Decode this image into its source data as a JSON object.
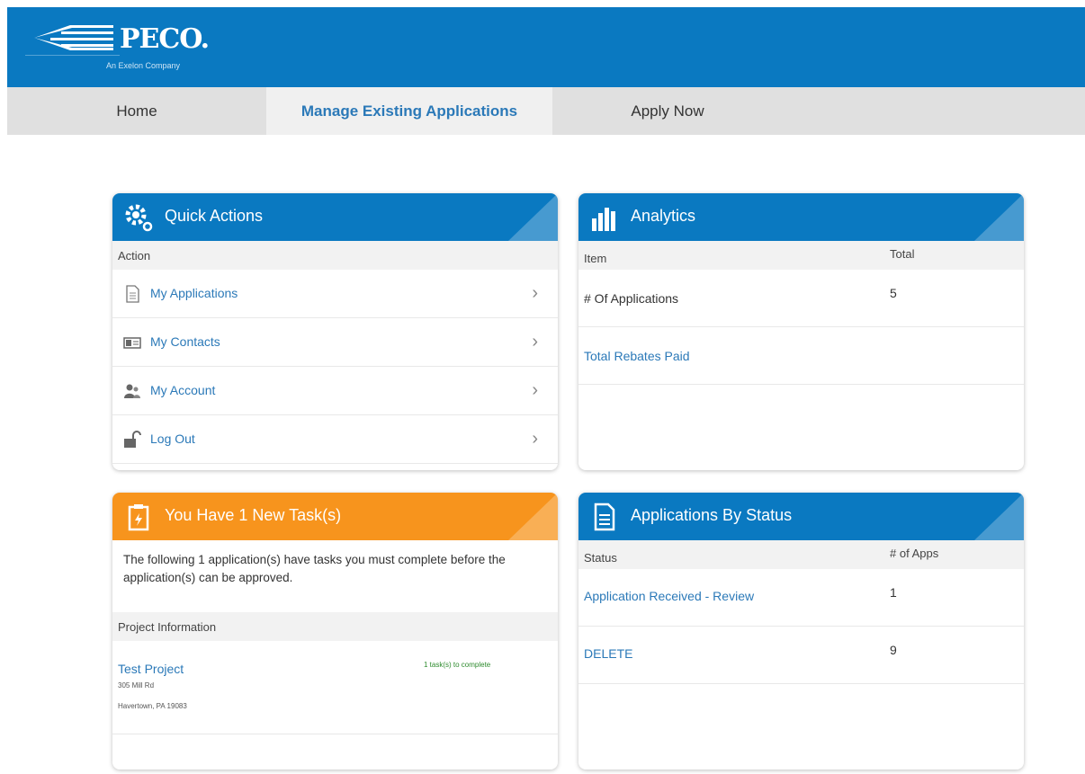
{
  "header": {
    "logo_text": "PECO.",
    "logo_sub": "An Exelon Company",
    "brand_color": "#0a79c1"
  },
  "nav": {
    "items": [
      {
        "label": "Home"
      },
      {
        "label": "Manage Existing Applications"
      },
      {
        "label": "Apply Now"
      }
    ]
  },
  "quick_actions": {
    "title": "Quick Actions",
    "column": "Action",
    "rows": [
      {
        "label": "My Applications",
        "icon": "document-icon"
      },
      {
        "label": "My Contacts",
        "icon": "contact-card-icon"
      },
      {
        "label": "My Account",
        "icon": "users-icon"
      },
      {
        "label": "Log Out",
        "icon": "unlock-icon"
      }
    ],
    "chevron": "›"
  },
  "analytics": {
    "title": "Analytics",
    "col_item": "Item",
    "col_total": "Total",
    "rows": [
      {
        "label": "# Of Applications",
        "value": "5"
      },
      {
        "label": "Total Rebates Paid",
        "value": ""
      }
    ]
  },
  "tasks": {
    "title": "You Have 1 New Task(s)",
    "description": "The following 1 application(s) have tasks you must complete before the application(s) can be approved.",
    "col": "Project Information",
    "project": {
      "name": "Test Project",
      "address1": "305 Mill Rd",
      "address2": "Havertown, PA 19083",
      "tasks_note": "1 task(s) to complete"
    },
    "accent": "#f7941d"
  },
  "status": {
    "title": "Applications By Status",
    "col_status": "Status",
    "col_apps": "# of Apps",
    "rows": [
      {
        "label": "Application Received - Review",
        "value": "1"
      },
      {
        "label": "DELETE",
        "value": "9"
      }
    ]
  }
}
